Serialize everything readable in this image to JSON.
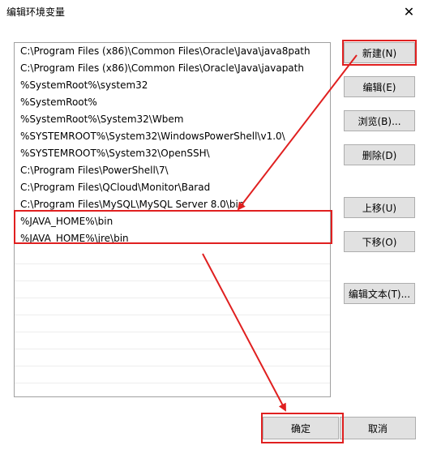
{
  "dialog": {
    "title": "编辑环境变量",
    "close_glyph": "✕"
  },
  "path_list": {
    "items": [
      "C:\\Program Files (x86)\\Common Files\\Oracle\\Java\\java8path",
      "C:\\Program Files (x86)\\Common Files\\Oracle\\Java\\javapath",
      "%SystemRoot%\\system32",
      "%SystemRoot%",
      "%SystemRoot%\\System32\\Wbem",
      "%SYSTEMROOT%\\System32\\WindowsPowerShell\\v1.0\\",
      "%SYSTEMROOT%\\System32\\OpenSSH\\",
      "C:\\Program Files\\PowerShell\\7\\",
      "C:\\Program Files\\QCloud\\Monitor\\Barad",
      "C:\\Program Files\\MySQL\\MySQL Server 8.0\\bin",
      "%JAVA_HOME%\\bin",
      "%JAVA_HOME%\\jre\\bin"
    ]
  },
  "buttons": {
    "new": "新建(N)",
    "edit": "编辑(E)",
    "browse": "浏览(B)...",
    "delete": "删除(D)",
    "move_up": "上移(U)",
    "move_down": "下移(O)",
    "edit_text": "编辑文本(T)...",
    "ok": "确定",
    "cancel": "取消"
  },
  "annotation": {
    "color": "#e02020"
  }
}
